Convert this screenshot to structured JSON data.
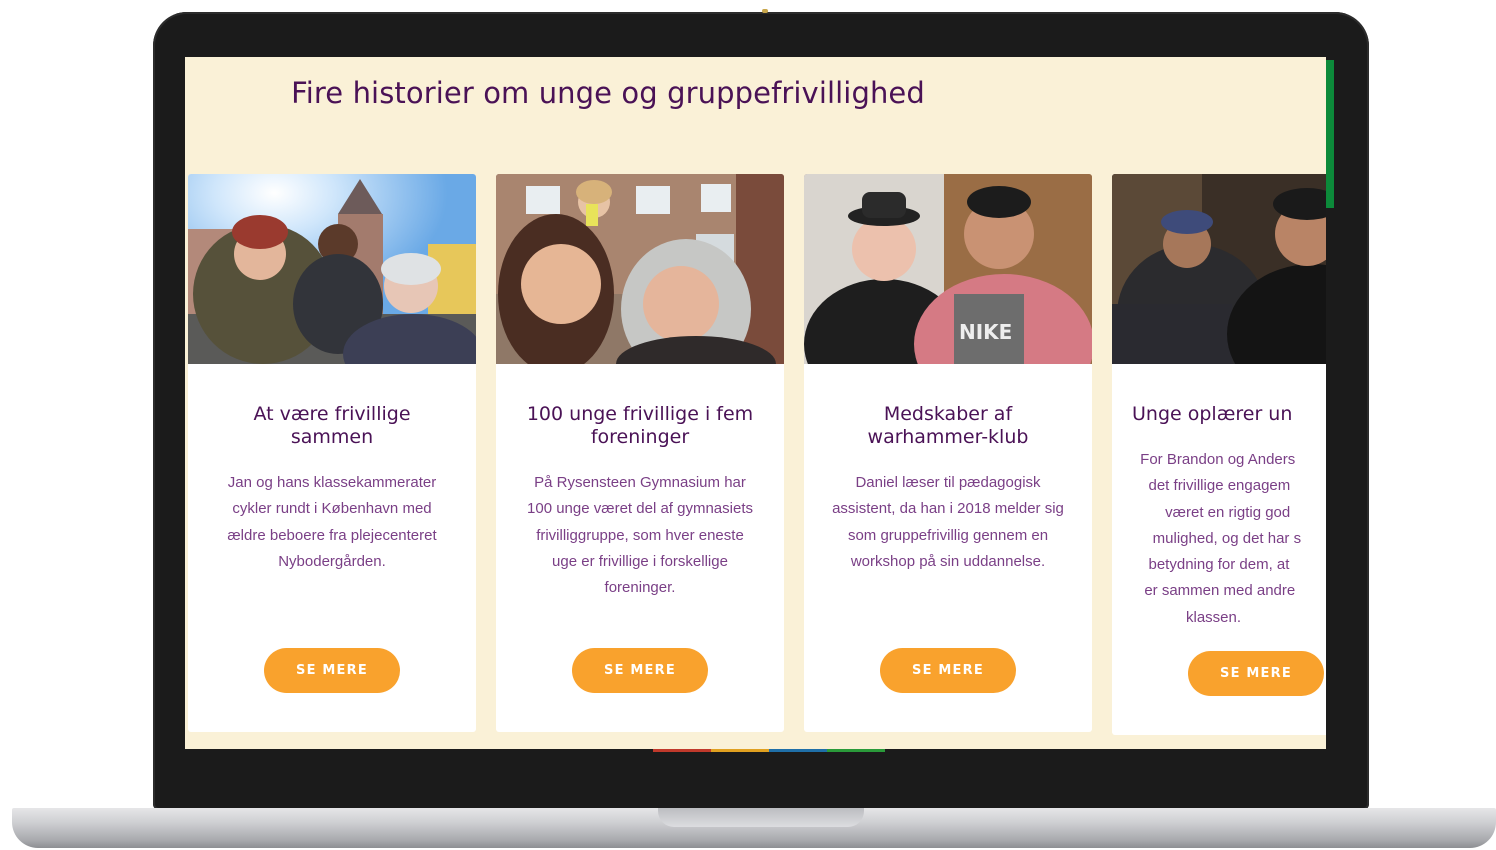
{
  "page": {
    "title": "Fire historier om unge og gruppefrivillighed"
  },
  "colors": {
    "background": "#faf1d7",
    "heading": "#4a1256",
    "body_text": "#7a3f86",
    "button": "#f9a22d",
    "button_text": "#ffffff",
    "card": "#ffffff"
  },
  "cards": [
    {
      "photo": "photo-selfie-bikes-copenhagen",
      "title": "At være frivillige sammen",
      "text": "Jan og hans klassekammerater cykler rundt i København med ældre beboere fra plejecenteret Nybodergården.",
      "button": "SE MERE"
    },
    {
      "photo": "photo-selfie-street",
      "title": "100 unge frivillige i fem foreninger",
      "text": "På Rysensteen Gymnasium har 100 unge været del af gymnasiets frivilliggruppe, som hver eneste uge er frivillige i forskellige foreninger.",
      "button": "SE MERE"
    },
    {
      "photo": "photo-two-young-men",
      "title": "Medskaber af warhammer-klub",
      "text": "Daniel læser til pædagogisk assistent, da han i 2018 melder sig som gruppefrivillig gennem en workshop på sin uddannelse.",
      "button": "SE MERE"
    },
    {
      "photo": "photo-laptop-teaching",
      "title": "Unge oplærer un",
      "text": " For Brandon og Anders\n   det frivillige engagem\n       været en rigtig god\n    mulighed, og det har s\n   betydning for dem, at \n  er sammen med andre\n            klassen.",
      "button": "SE MERE"
    }
  ]
}
